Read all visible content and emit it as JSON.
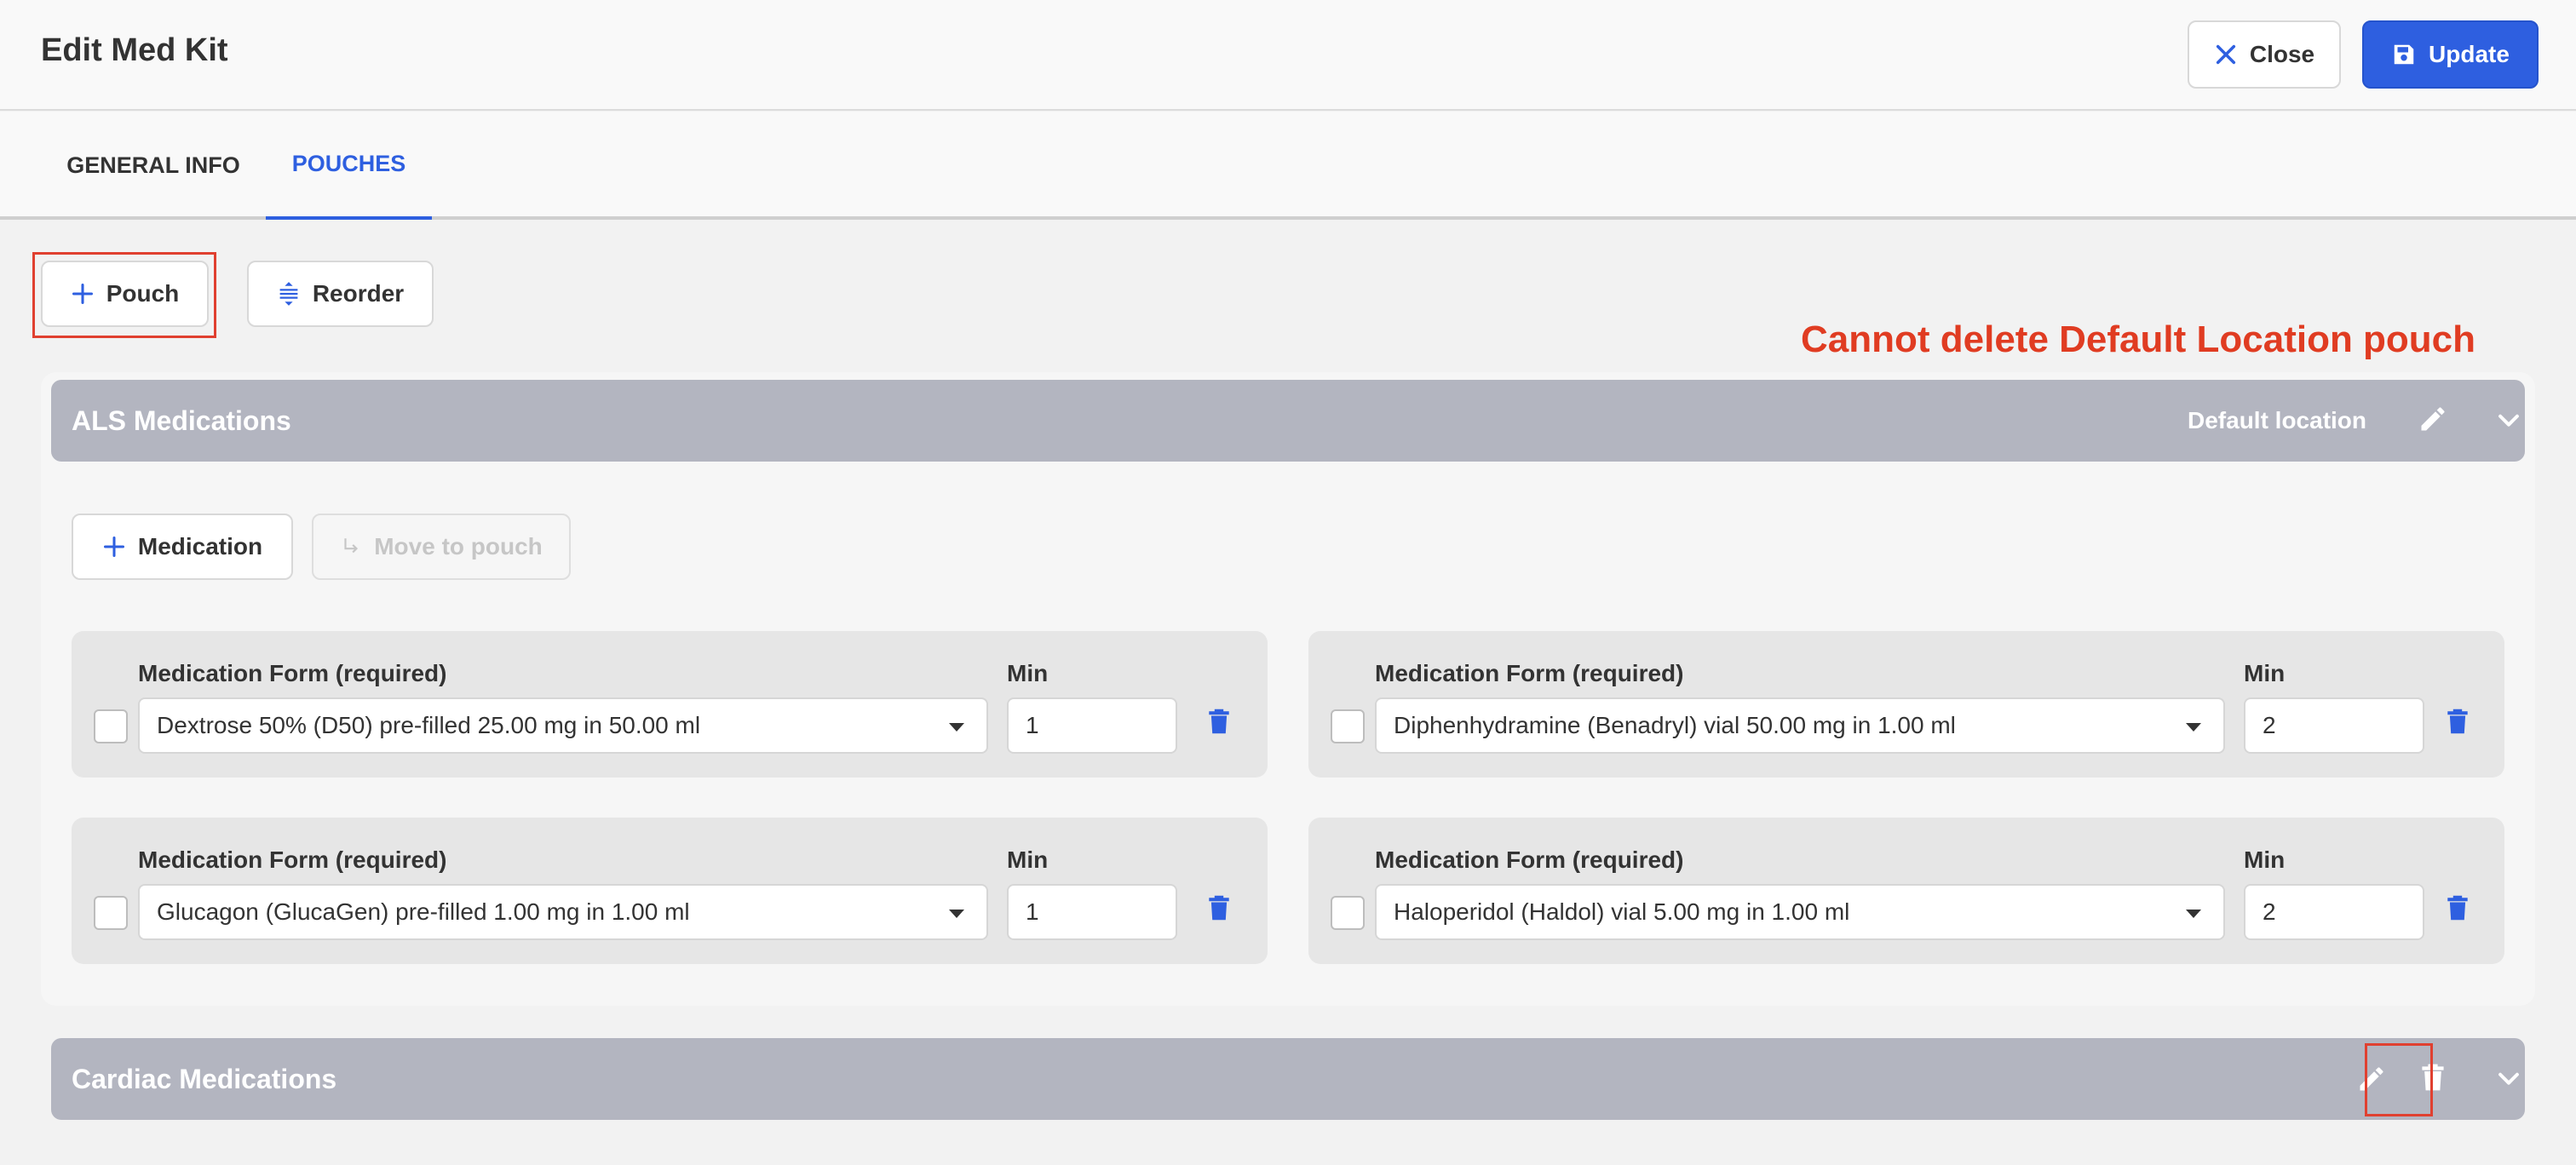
{
  "header": {
    "title": "Edit Med Kit",
    "close_label": "Close",
    "update_label": "Update"
  },
  "tabs": [
    {
      "label": "GENERAL INFO",
      "active": false
    },
    {
      "label": "POUCHES",
      "active": true
    }
  ],
  "toolbar": {
    "pouch_label": "Pouch",
    "reorder_label": "Reorder"
  },
  "annotation": "Cannot delete Default Location pouch",
  "pouches": [
    {
      "name": "ALS Medications",
      "default_location_label": "Default location",
      "medication_button": "Medication",
      "move_button": "Move to pouch",
      "medications": [
        {
          "form_label": "Medication Form (required)",
          "min_label": "Min",
          "form_value": "Dextrose 50% (D50) pre-filled 25.00 mg in 50.00 ml",
          "min_value": "1"
        },
        {
          "form_label": "Medication Form (required)",
          "min_label": "Min",
          "form_value": "Diphenhydramine (Benadryl) vial 50.00 mg in 1.00 ml",
          "min_value": "2"
        },
        {
          "form_label": "Medication Form (required)",
          "min_label": "Min",
          "form_value": "Glucagon (GlucaGen) pre-filled 1.00 mg in 1.00 ml",
          "min_value": "1"
        },
        {
          "form_label": "Medication Form (required)",
          "min_label": "Min",
          "form_value": "Haloperidol (Haldol) vial 5.00 mg in 1.00 ml",
          "min_value": "2"
        }
      ]
    },
    {
      "name": "Cardiac Medications"
    }
  ],
  "colors": {
    "accent": "#2e5fe0",
    "annotation": "#e03c22",
    "pouch_header": "#b3b5c0"
  }
}
